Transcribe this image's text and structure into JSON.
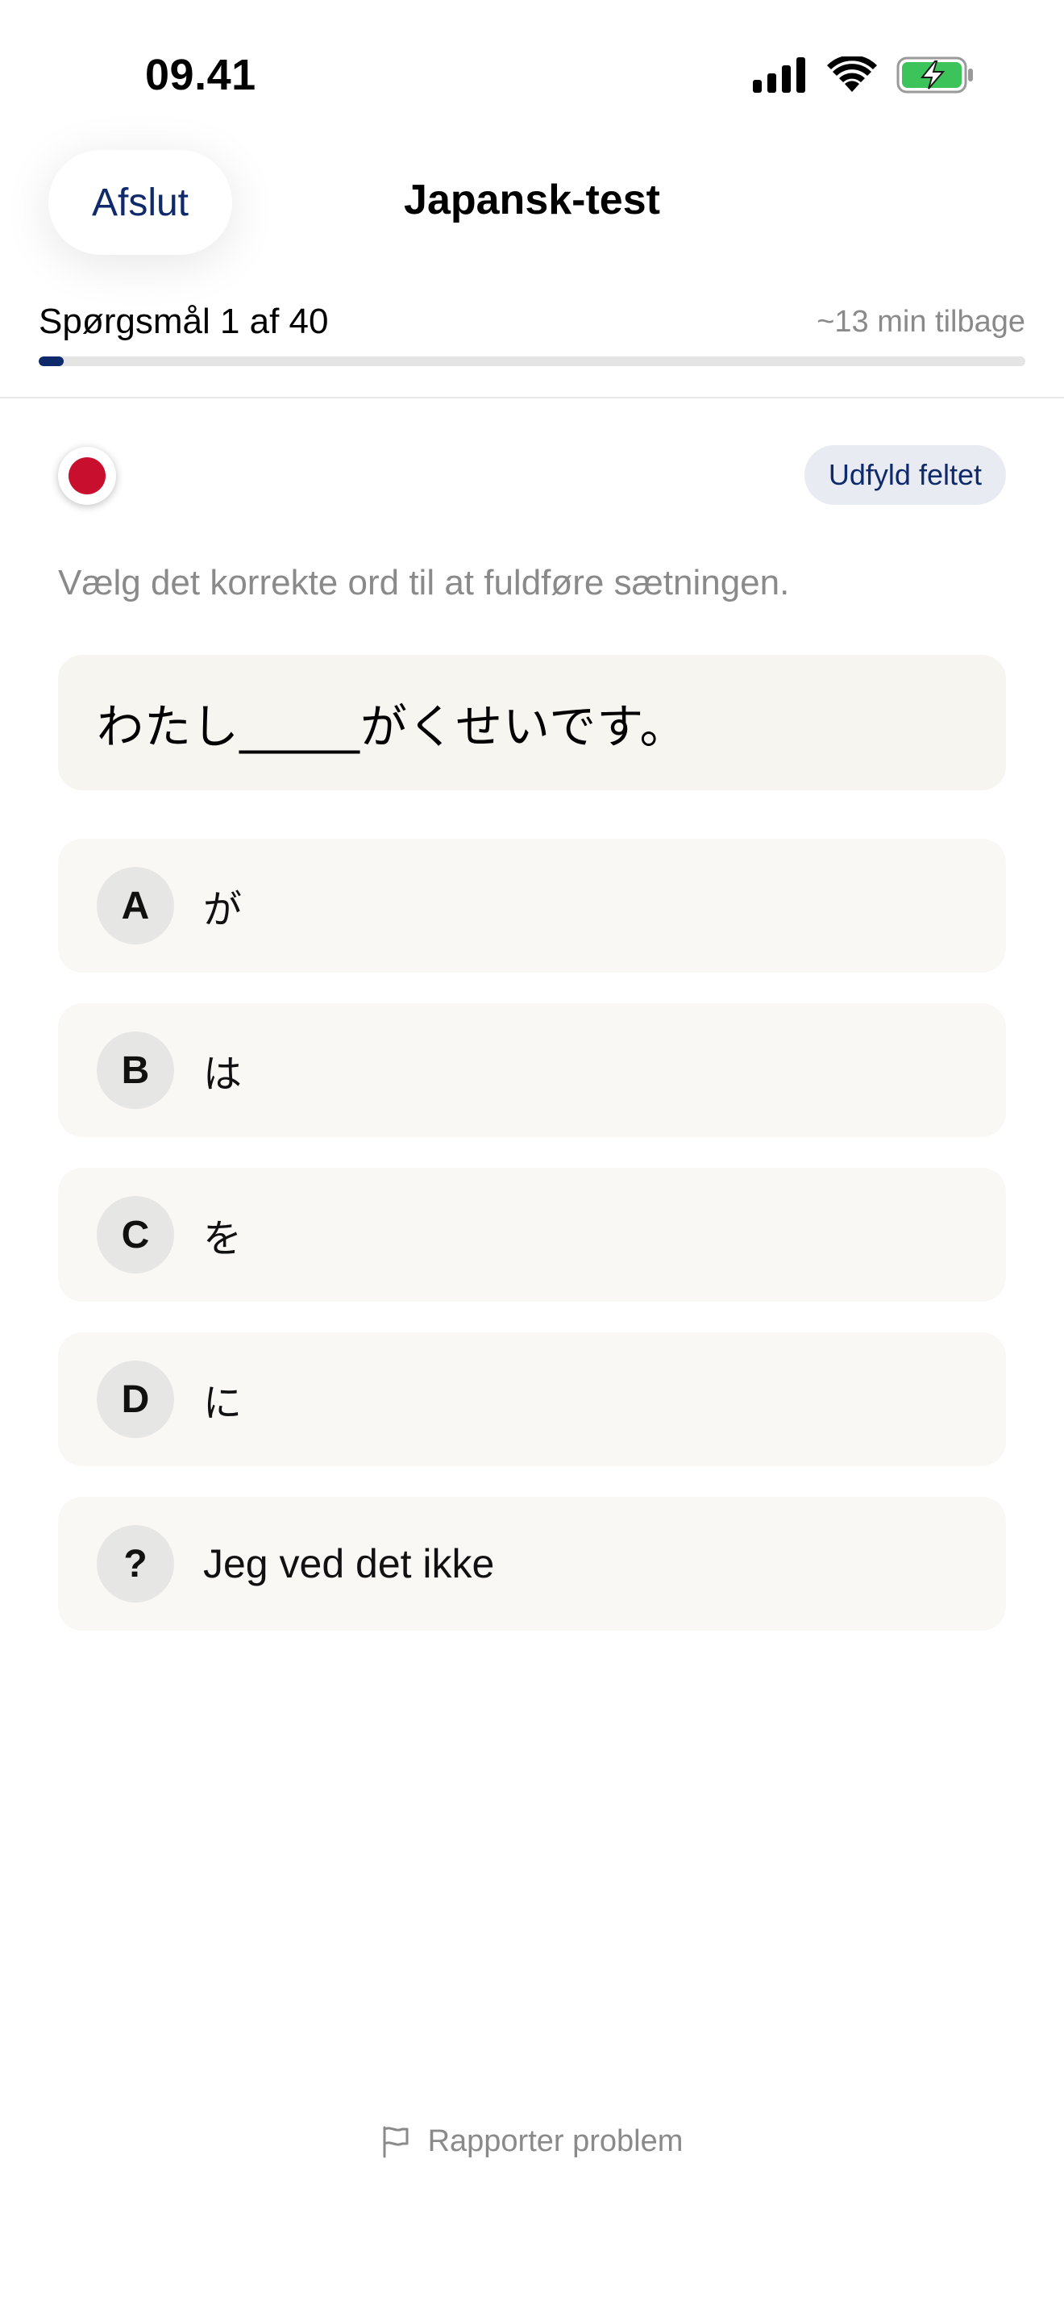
{
  "status_bar": {
    "time": "09.41"
  },
  "header": {
    "exit_label": "Afslut",
    "title": "Japansk-test"
  },
  "progress": {
    "label": "Spørgsmål 1 af 40",
    "time_left": "~13 min tilbage",
    "fraction": 0.025,
    "accent": "#0f2a6b"
  },
  "question": {
    "flag_icon": "japan-flag-icon",
    "type_badge": "Udfyld feltet",
    "instruction": "Vælg det korrekte ord til at fuldføre sætningen.",
    "sentence": "わたし_____がくせいです。"
  },
  "options": [
    {
      "letter": "A",
      "text": "が"
    },
    {
      "letter": "B",
      "text": "は"
    },
    {
      "letter": "C",
      "text": "を"
    },
    {
      "letter": "D",
      "text": "に"
    },
    {
      "letter": "?",
      "text": "Jeg ved det ikke"
    }
  ],
  "footer": {
    "report_label": "Rapporter problem",
    "report_icon": "flag-outline-icon"
  }
}
